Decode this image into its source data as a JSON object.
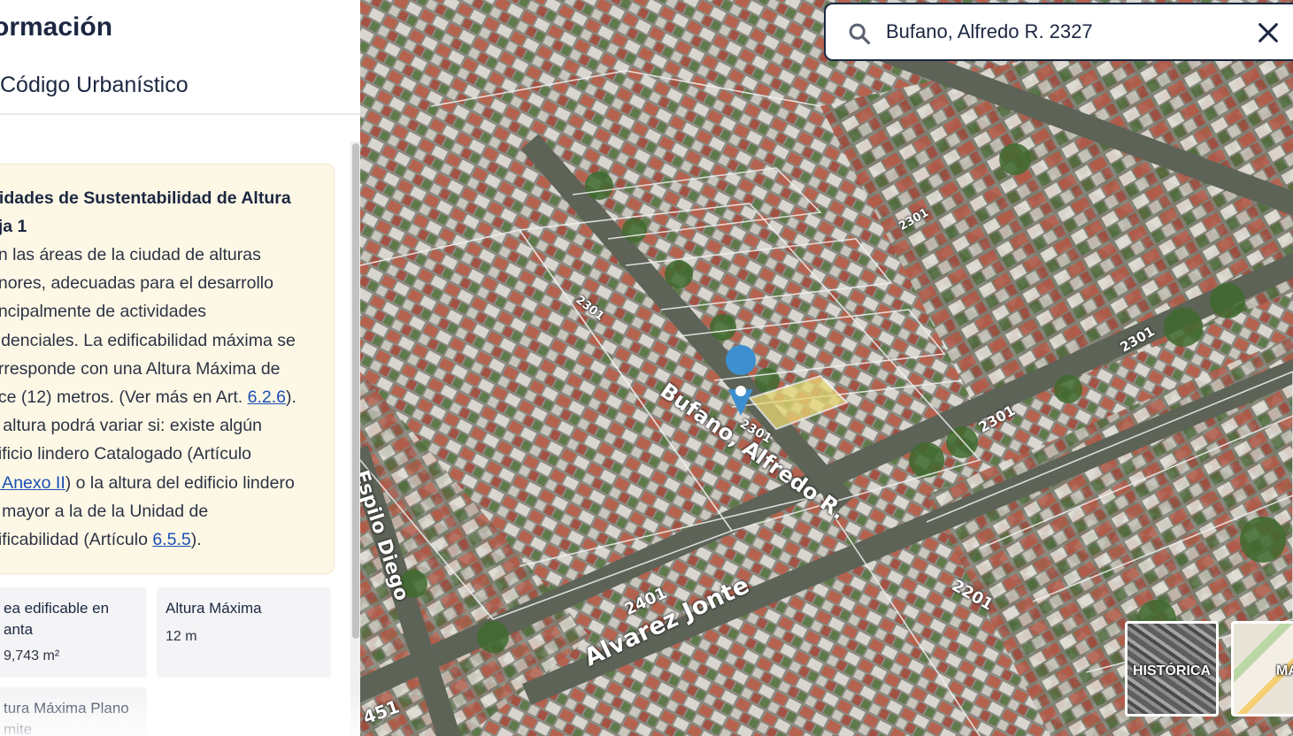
{
  "panel": {
    "title": "ormación",
    "subtitle": "Código Urbanístico",
    "card": {
      "heading_lines": [
        "nidades de Sustentabilidad de Altura",
        "aja 1"
      ],
      "body_lines": [
        {
          "text": "on las áreas de la ciudad de alturas"
        },
        {
          "text": "enores, adecuadas para el desarrollo"
        },
        {
          "text": "rincipalmente de actividades"
        },
        {
          "text": "sidenciales. La edificabilidad máxima se"
        },
        {
          "text": "orresponde con una Altura Máxima de"
        },
        {
          "pre": "oce (12) metros. (Ver más en Art. ",
          "link": "6.2.6",
          "post": ")."
        },
        {
          "text": "a altura podrá variar si: existe algún"
        },
        {
          "text": "dificio lindero Catalogado (Artículo"
        },
        {
          "pre": "",
          "link": "6 Anexo II",
          "post": ") o la altura del edificio lindero"
        },
        {
          "text": "s mayor a la de la Unidad de"
        },
        {
          "pre": "dificabilidad (Artículo ",
          "link": "6.5.5",
          "post": ")."
        }
      ]
    },
    "stats": [
      {
        "label_lines": [
          "ea edificable en",
          "anta"
        ],
        "value": "9,743 m²"
      },
      {
        "label_lines": [
          "Altura Máxima"
        ],
        "value": "12 m"
      },
      {
        "label_lines": [
          "tura Máxima Plano",
          "mite"
        ],
        "value": ""
      }
    ]
  },
  "search": {
    "value": "Bufano, Alfredo R. 2327"
  },
  "map": {
    "streets": {
      "bufano": "Bufano, Alfredo R.",
      "alvarez": "Alvarez Jonte",
      "espilo": "Espilo Diego"
    },
    "numbers": [
      "2301",
      "2301",
      "2301",
      "2301",
      "2401",
      "2201",
      "451",
      "2301"
    ],
    "layers": {
      "historica": "HISTÓRICA",
      "mapa": "MAPA"
    },
    "colors": {
      "marker": "#3d8fcf",
      "selected_parcel": "#e8d873"
    }
  }
}
